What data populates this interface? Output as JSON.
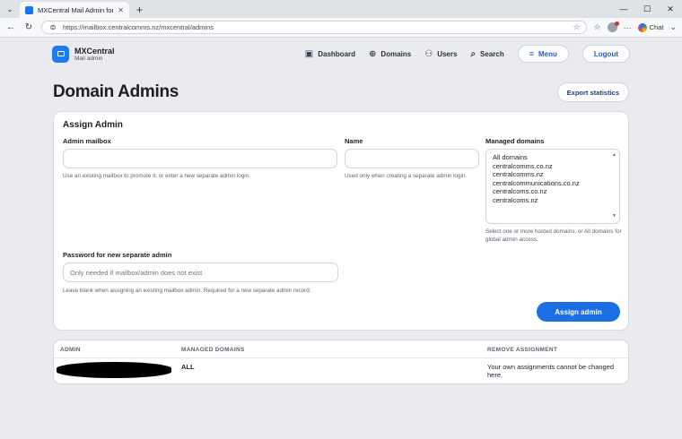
{
  "browser": {
    "tab_title": "MXCentral Mail Admin for CCL",
    "url": "https://mailbox.centralcomms.nz/mxcentral/admins",
    "chat_label": "Chat"
  },
  "app": {
    "brand_name": "MXCentral",
    "brand_sub": "Mail admin",
    "nav": {
      "dashboard": "Dashboard",
      "domains": "Domains",
      "users": "Users",
      "search": "Search",
      "menu": "Menu",
      "logout": "Logout"
    }
  },
  "page": {
    "title": "Domain Admins",
    "export_label": "Export statistics"
  },
  "assign": {
    "title": "Assign Admin",
    "mailbox_label": "Admin mailbox",
    "mailbox_value": "",
    "mailbox_help": "Use an existing mailbox to promote it, or enter a new separate admin login.",
    "name_label": "Name",
    "name_value": "",
    "name_help": "Used only when creating a separate admin login.",
    "domains_label": "Managed domains",
    "domains_options": [
      "All domains",
      "centralcomms.co.nz",
      "centralcomms.nz",
      "centralcommunications.co.nz",
      "centralcoms.co.nz",
      "centralcoms.nz"
    ],
    "domains_help": "Select one or more hosted domains, or All domains for global admin access.",
    "password_label": "Password for new separate admin",
    "password_placeholder": "Only needed if mailbox/admin does not exist",
    "password_help": "Leave blank when assigning an existing mailbox admin. Required for a new separate admin record.",
    "submit_label": "Assign admin"
  },
  "table": {
    "headers": [
      "ADMIN",
      "MANAGED DOMAINS",
      "REMOVE ASSIGNMENT"
    ],
    "rows": [
      {
        "domains": "ALL",
        "remove": "Your own assignments cannot be changed here."
      }
    ]
  },
  "colors": {
    "accent": "#1d6fe8",
    "page_bg": "#e9ebee"
  }
}
